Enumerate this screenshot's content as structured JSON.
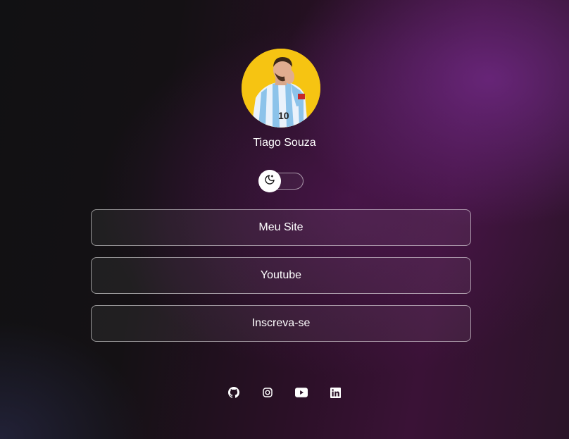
{
  "profile": {
    "name": "Tiago Souza",
    "avatar_icon": "profile-photo"
  },
  "theme_toggle": {
    "icon": "moon-icon",
    "state": "dark"
  },
  "links": [
    {
      "label": "Meu Site"
    },
    {
      "label": "Youtube"
    },
    {
      "label": "Inscreva-se"
    }
  ],
  "socials": [
    {
      "icon": "github-icon"
    },
    {
      "icon": "instagram-icon"
    },
    {
      "icon": "youtube-icon"
    },
    {
      "icon": "linkedin-icon"
    }
  ],
  "colors": {
    "avatar_bg": "#f6c412",
    "text": "#ffffff",
    "accent_glow": "#6e2882"
  }
}
